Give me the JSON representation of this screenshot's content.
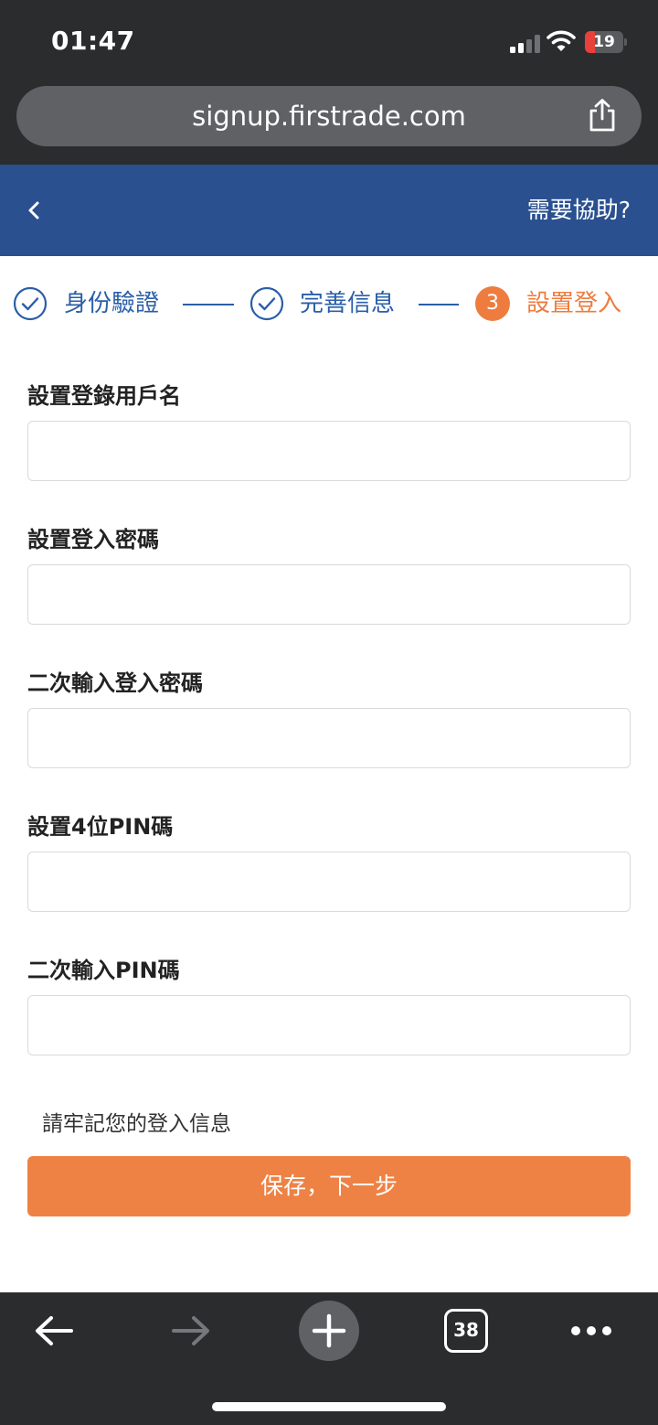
{
  "status_bar": {
    "time": "01:47",
    "battery_level": "19"
  },
  "browser": {
    "url": "signup.firstrade.com",
    "icons": [
      "share-icon",
      "back-arrow-icon",
      "forward-arrow-icon",
      "new-tab-plus-icon",
      "tabs-icon",
      "more-icon"
    ],
    "tab_count": "38"
  },
  "header": {
    "back_icon": "chevron-left-icon",
    "help_label": "需要協助?",
    "background_color": "#2a5090"
  },
  "stepper": {
    "steps": [
      {
        "label": "身份驗證",
        "state": "completed"
      },
      {
        "label": "完善信息",
        "state": "completed"
      },
      {
        "label": "設置登入",
        "state": "current",
        "number": "3"
      }
    ],
    "completed_color": "#2a5ea8",
    "current_color": "#ee7c3f"
  },
  "form": {
    "fields": [
      {
        "label": "設置登錄用戶名",
        "value": "",
        "placeholder": ""
      },
      {
        "label": "設置登入密碼",
        "value": "",
        "placeholder": ""
      },
      {
        "label": "二次輸入登入密碼",
        "value": "",
        "placeholder": ""
      },
      {
        "label": "設置4位PIN碼",
        "value": "",
        "placeholder": ""
      },
      {
        "label": "二次輸入PIN碼",
        "value": "",
        "placeholder": ""
      }
    ],
    "hint": "請牢記您的登入信息",
    "submit_label": "保存，下一步",
    "button_color": "#ee8244"
  }
}
